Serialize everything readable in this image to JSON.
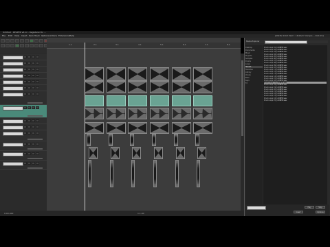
{
  "window": {
    "title": "Untitled - REAPER v6.xx - Registered to ..."
  },
  "menubar": {
    "items": [
      "File",
      "Edit",
      "View",
      "Insert",
      "Item",
      "Track",
      "Options",
      "Actions",
      "Extensions",
      "Help"
    ],
    "right_text": "[48kHz 24bit WAV : 16/16ch 512spls ~10/10ms WASAPI]"
  },
  "ruler": {
    "marks": [
      "1.1",
      "2.1",
      "3.1",
      "4.1",
      "5.1",
      "6.1",
      "7.1",
      "8.1"
    ]
  },
  "tracks": [
    {
      "name": "",
      "selected": false
    },
    {
      "name": "",
      "selected": false
    },
    {
      "name": "",
      "selected": false
    },
    {
      "name": "",
      "selected": false
    },
    {
      "name": "",
      "selected": false
    },
    {
      "name": "",
      "selected": false
    },
    {
      "name": "",
      "selected": false
    },
    {
      "name": "",
      "selected": true
    },
    {
      "name": "",
      "selected": false
    },
    {
      "name": "",
      "selected": false
    },
    {
      "name": "",
      "selected": false
    },
    {
      "name": "",
      "selected": false
    },
    {
      "name": "",
      "selected": false
    },
    {
      "name": "",
      "selected": false
    }
  ],
  "statusbar": {
    "time": "1.1.00",
    "left_text": "0:00.000"
  },
  "browser": {
    "title": "Media Explorer",
    "search_placeholder": "Search",
    "folders": [
      "Desktop",
      "Documents",
      "Music",
      "Projects",
      "Samples",
      "Drums",
      "Loops",
      "Recent",
      "Favorites",
      "Library",
      "Vocals",
      "Bass",
      "Keys",
      "FX"
    ],
    "files": [
      "Drum Loop 01_120BPM.wav",
      "Drum Loop 02_120BPM.wav",
      "Drum Loop 03_120BPM.wav",
      "Drum Loop 04_120BPM.wav",
      "Drum Loop 05_120BPM.wav",
      "Drum Loop 06_120BPM.wav",
      "Drum Loop 07_120BPM.wav",
      "Drum Loop 08_120BPM.wav",
      "Drum Loop 09_120BPM.wav",
      "Drum Loop 10_120BPM.wav",
      "Drum Loop 11_120BPM.wav",
      "Drum Loop 12_120BPM.wav",
      "Drum Loop 13_120BPM.wav",
      "Drum Loop 14_120BPM.wav",
      "Drum Loop 15_120BPM.wav",
      "Drum Loop 16_120BPM.wav",
      "Drum Loop 17_120BPM.wav",
      "Drum Loop 18_120BPM.wav",
      "Drum Loop 19_120BPM.wav",
      "Drum Loop 20_120BPM.wav",
      "Drum Loop 21_120BPM.wav",
      "Drum Loop 22_120BPM.wav",
      "Drum Loop 23_120BPM.wav",
      "Drum Loop 24_120BPM.wav",
      "Drum Loop 25_120BPM.wav"
    ],
    "selected_file_index": 16,
    "buttons": [
      "Play",
      "Stop",
      "Insert",
      "Options"
    ]
  },
  "colors": {
    "selected_track": "#4a8a7a",
    "green_clip": "#6aa393",
    "arrange_bg": "#3c3c3c"
  }
}
